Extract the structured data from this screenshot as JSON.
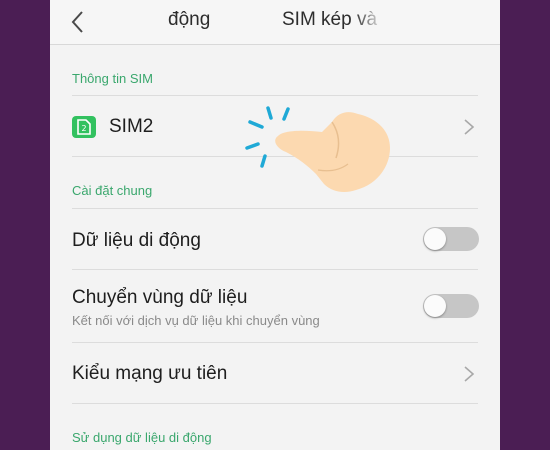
{
  "header": {
    "title_left": "động",
    "title_right": "SIM kép và"
  },
  "sections": {
    "sim_info": "Thông tin SIM",
    "general_settings": "Cài đặt chung",
    "mobile_data_usage": "Sử dụng dữ liệu di động"
  },
  "rows": {
    "sim2": {
      "label": "SIM2",
      "icon": "sim-card-icon"
    },
    "mobile_data": {
      "label": "Dữ liệu di động",
      "toggle_on": false
    },
    "data_roaming": {
      "label": "Chuyển vùng dữ liệu",
      "sublabel": "Kết nối với dịch vụ dữ liệu khi chuyển vùng",
      "toggle_on": false
    },
    "network_type": {
      "label": "Kiểu mạng ưu tiên"
    }
  },
  "colors": {
    "accent": "#3aa76d",
    "sim_icon": "#32c15f",
    "background": "#4b1e54"
  }
}
